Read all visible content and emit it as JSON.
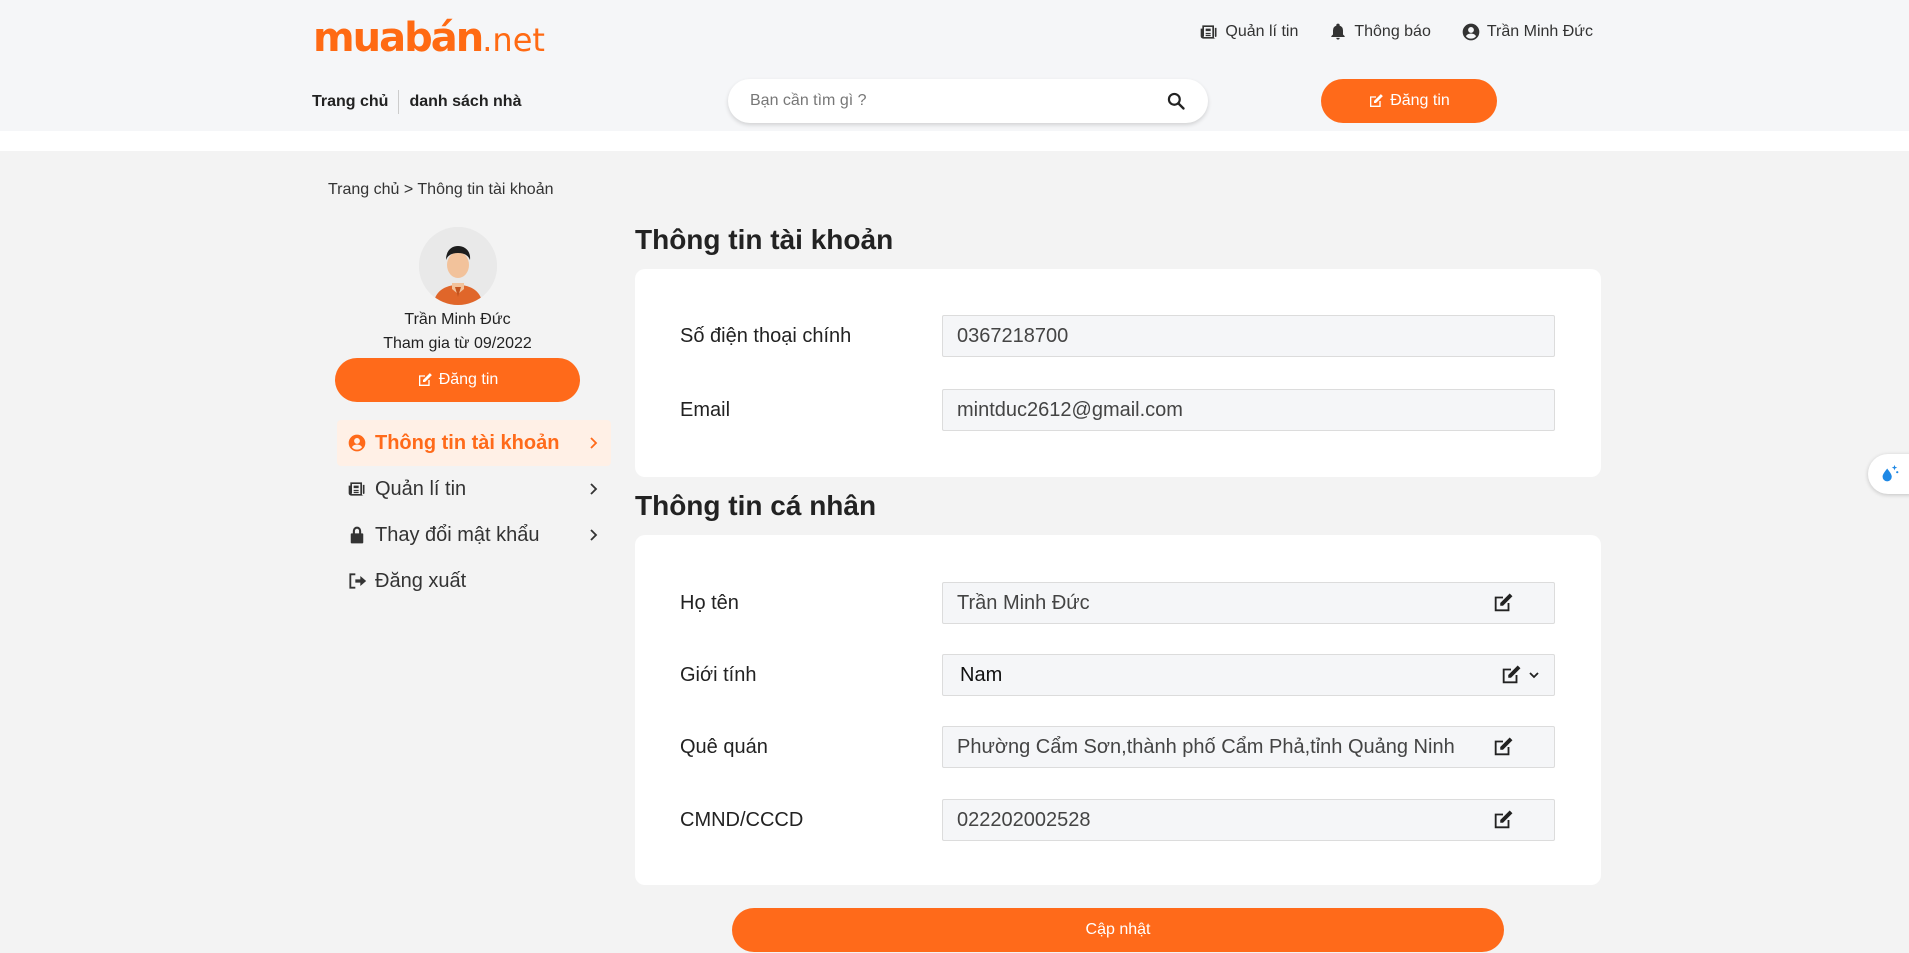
{
  "header": {
    "logo_main": "muabán",
    "logo_suffix": ".net",
    "links": {
      "manage_posts": "Quản lí tin",
      "notifications": "Thông báo",
      "user_name": "Trần Minh Đức"
    },
    "nav": {
      "home": "Trang chủ",
      "house_list": "danh sách nhà"
    },
    "search_placeholder": "Bạn cần tìm gì ?",
    "post_button": "Đăng tin"
  },
  "breadcrumb": "Trang chủ > Thông tin tài khoản",
  "sidebar": {
    "name": "Trần Minh Đức",
    "joined": "Tham gia từ 09/2022",
    "post_button": "Đăng tin",
    "menu": [
      {
        "label": "Thông tin tài khoản",
        "icon": "user-circle-icon"
      },
      {
        "label": "Quản lí tin",
        "icon": "newspaper-icon"
      },
      {
        "label": "Thay đổi mật khẩu",
        "icon": "lock-icon"
      },
      {
        "label": "Đăng xuất",
        "icon": "sign-out-icon"
      }
    ]
  },
  "account": {
    "title": "Thông tin tài khoản",
    "phone_label": "Số điện thoại chính",
    "phone_value": "0367218700",
    "email_label": "Email",
    "email_value": "mintduc2612@gmail.com"
  },
  "personal": {
    "title": "Thông tin cá nhân",
    "name_label": "Họ tên",
    "name_value": "Trần Minh Đức",
    "gender_label": "Giới tính",
    "gender_value": "Nam",
    "hometown_label": "Quê quán",
    "hometown_value": "Phường Cẩm Sơn,thành phố Cẩm Phả,tỉnh Quảng Ninh",
    "id_label": "CMND/CCCD",
    "id_value": "022202002528"
  },
  "update_button": "Cập nhật",
  "colors": {
    "accent": "#ff6a1a",
    "active_bg": "#fff0e6"
  }
}
